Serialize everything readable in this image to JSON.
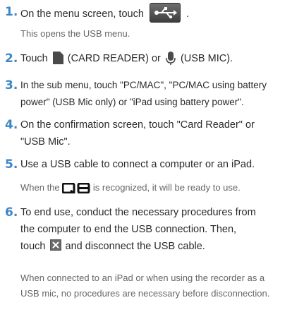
{
  "steps": [
    {
      "number": "1.",
      "text_before": "On the menu screen, touch",
      "text_after": ".",
      "note": "This opens the USB menu."
    },
    {
      "number": "2.",
      "text_touch": "Touch",
      "card_label": "(CARD READER) or",
      "mic_label": "(USB MIC)."
    },
    {
      "number": "3.",
      "line1": "In the sub menu, touch \"PC/MAC\", \"PC/MAC using battery",
      "line2": "power\" (USB Mic only) or \"iPad using battery power\"."
    },
    {
      "number": "4.",
      "line1": "On the confirmation screen, touch \"Card Reader\" or",
      "line2": "\"USB Mic\"."
    },
    {
      "number": "5.",
      "line1": "Use a USB cable to connect a computer or an iPad.",
      "note_before": "When the",
      "logo": "Q8",
      "note_after": "is recognized, it will be ready to use."
    },
    {
      "number": "6.",
      "line1": "To end use, conduct the necessary procedures from",
      "line2": "the computer to end the USB connection. Then,",
      "line3_before": "touch",
      "line3_after": "and disconnect the USB cable.",
      "note_line1": "When connected to an iPad or when using the recorder as a",
      "note_line2": "USB mic, no procedures are necessary before disconnection."
    }
  ],
  "colors": {
    "step_number": "#3d86c6",
    "body_text": "#2a2a2a",
    "note_text": "#666666"
  },
  "icons": {
    "usb_menu_button": "usb-icon",
    "card_reader": "sd-card-icon",
    "usb_mic": "microphone-icon",
    "close": "close-icon"
  }
}
